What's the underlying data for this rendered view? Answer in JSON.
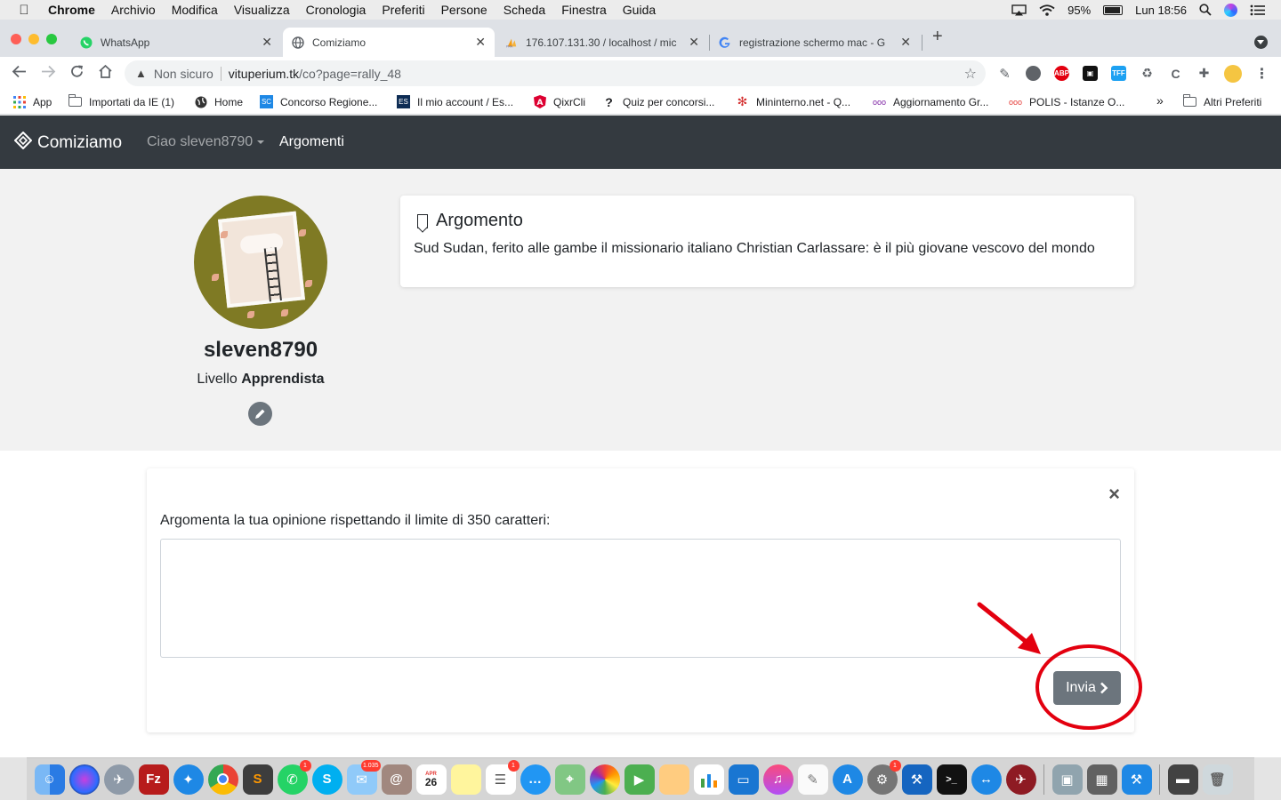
{
  "menubar": {
    "app": "Chrome",
    "items": [
      "Archivio",
      "Modifica",
      "Visualizza",
      "Cronologia",
      "Preferiti",
      "Persone",
      "Scheda",
      "Finestra",
      "Guida"
    ],
    "battery": "95%",
    "clock": "Lun 18:56"
  },
  "tabs": [
    {
      "title": "WhatsApp",
      "favicon": "whatsapp-icon"
    },
    {
      "title": "Comiziamo",
      "favicon": "globe-icon",
      "active": true
    },
    {
      "title": "176.107.131.30 / localhost / mic",
      "favicon": "phpmyadmin-icon"
    },
    {
      "title": "registrazione schermo mac - G",
      "favicon": "google-icon"
    }
  ],
  "toolbar": {
    "security_label": "Non sicuro",
    "url_host": "vituperium.tk",
    "url_path": "/co?page=rally_48"
  },
  "bookmarks": {
    "items": [
      "App",
      "Importati da IE (1)",
      "Home",
      "Concorso Regione...",
      "Il mio account / Es...",
      "QixrCli",
      "Quiz per concorsi...",
      "Mininterno.net - Q...",
      "Aggiornamento Gr...",
      "POLIS - Istanze O..."
    ],
    "overflow": "»",
    "other": "Altri Preferiti"
  },
  "site": {
    "brand": "Comiziamo",
    "user_menu": "Ciao sleven8790",
    "nav_link": "Argomenti"
  },
  "profile": {
    "username": "sleven8790",
    "level_prefix": "Livello",
    "level_name": "Apprendista"
  },
  "argument": {
    "title": "Argomento",
    "text": "Sud Sudan, ferito alle gambe il missionario italiano Christian Carlassare: è il più giovane vescovo del mondo"
  },
  "form": {
    "close": "×",
    "label": "Argomenta la tua opinione rispettando il limite di 350 caratteri:",
    "textarea_value": "",
    "submit": "Invia"
  },
  "annotation": {
    "color": "#e3000f"
  },
  "dock": {
    "badges": {
      "whatsapp": "1",
      "preview": "1.035",
      "reminders": "1",
      "preferences": "1"
    },
    "calendar_month": "APR",
    "calendar_day": "26"
  }
}
